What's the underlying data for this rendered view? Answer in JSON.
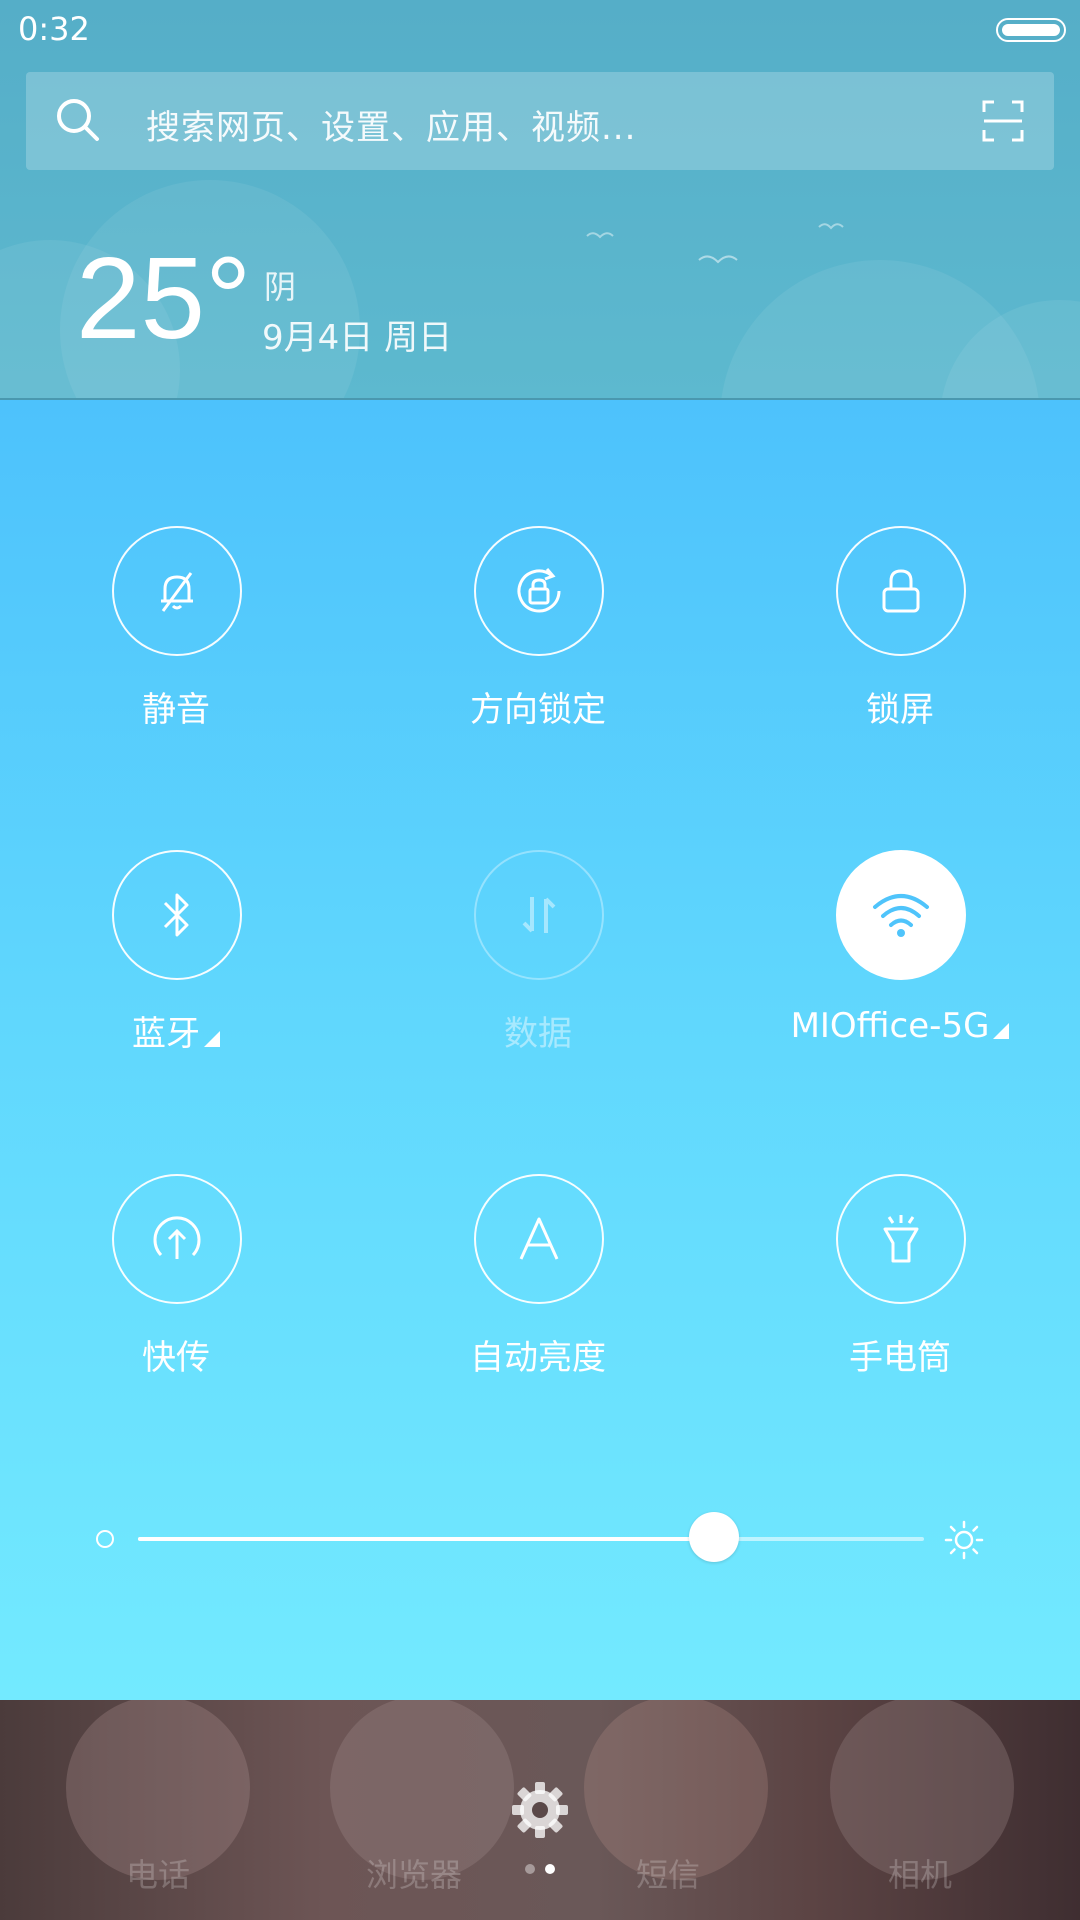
{
  "status_bar": {
    "time": "0:32"
  },
  "search": {
    "placeholder": "搜索网页、设置、应用、视频..."
  },
  "weather": {
    "temperature": "25°",
    "condition": "阴",
    "date": "9月4日 周日"
  },
  "toggles": [
    {
      "label": "静音",
      "icon": "bell-off-icon",
      "state": "off"
    },
    {
      "label": "方向锁定",
      "icon": "rotation-lock-icon",
      "state": "off"
    },
    {
      "label": "锁屏",
      "icon": "lock-icon",
      "state": "off"
    },
    {
      "label": "蓝牙",
      "icon": "bluetooth-icon",
      "state": "off",
      "has_more": true
    },
    {
      "label": "数据",
      "icon": "mobile-data-icon",
      "state": "disabled"
    },
    {
      "label": "MIOffice-5G",
      "icon": "wifi-icon",
      "state": "on",
      "has_more": true
    },
    {
      "label": "快传",
      "icon": "quick-transfer-icon",
      "state": "off"
    },
    {
      "label": "自动亮度",
      "icon": "auto-brightness-icon",
      "state": "off"
    },
    {
      "label": "手电筒",
      "icon": "flashlight-icon",
      "state": "off"
    }
  ],
  "brightness": {
    "level": 0.733
  },
  "dock": {
    "apps": [
      "电话",
      "浏览器",
      "短信",
      "相机"
    ]
  },
  "pager": {
    "pages": 2,
    "current": 2
  },
  "colors": {
    "accent": "#4fc4fb",
    "wifi_icon": "#4fc4fb"
  }
}
